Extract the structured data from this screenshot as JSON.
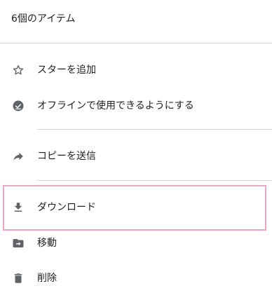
{
  "header": {
    "title": "6個のアイテム"
  },
  "menu": {
    "items": [
      {
        "icon": "star-outline-icon",
        "label": "スターを追加"
      },
      {
        "icon": "offline-check-icon",
        "label": "オフラインで使用できるようにする"
      },
      {
        "icon": "share-arrow-icon",
        "label": "コピーを送信"
      },
      {
        "icon": "download-icon",
        "label": "ダウンロード"
      },
      {
        "icon": "move-folder-icon",
        "label": "移動"
      },
      {
        "icon": "trash-icon",
        "label": "削除"
      }
    ]
  },
  "colors": {
    "icon": "#5f6368",
    "text": "#212121",
    "divider": "#d6d6d6",
    "highlight_border": "#e8a7c6"
  }
}
